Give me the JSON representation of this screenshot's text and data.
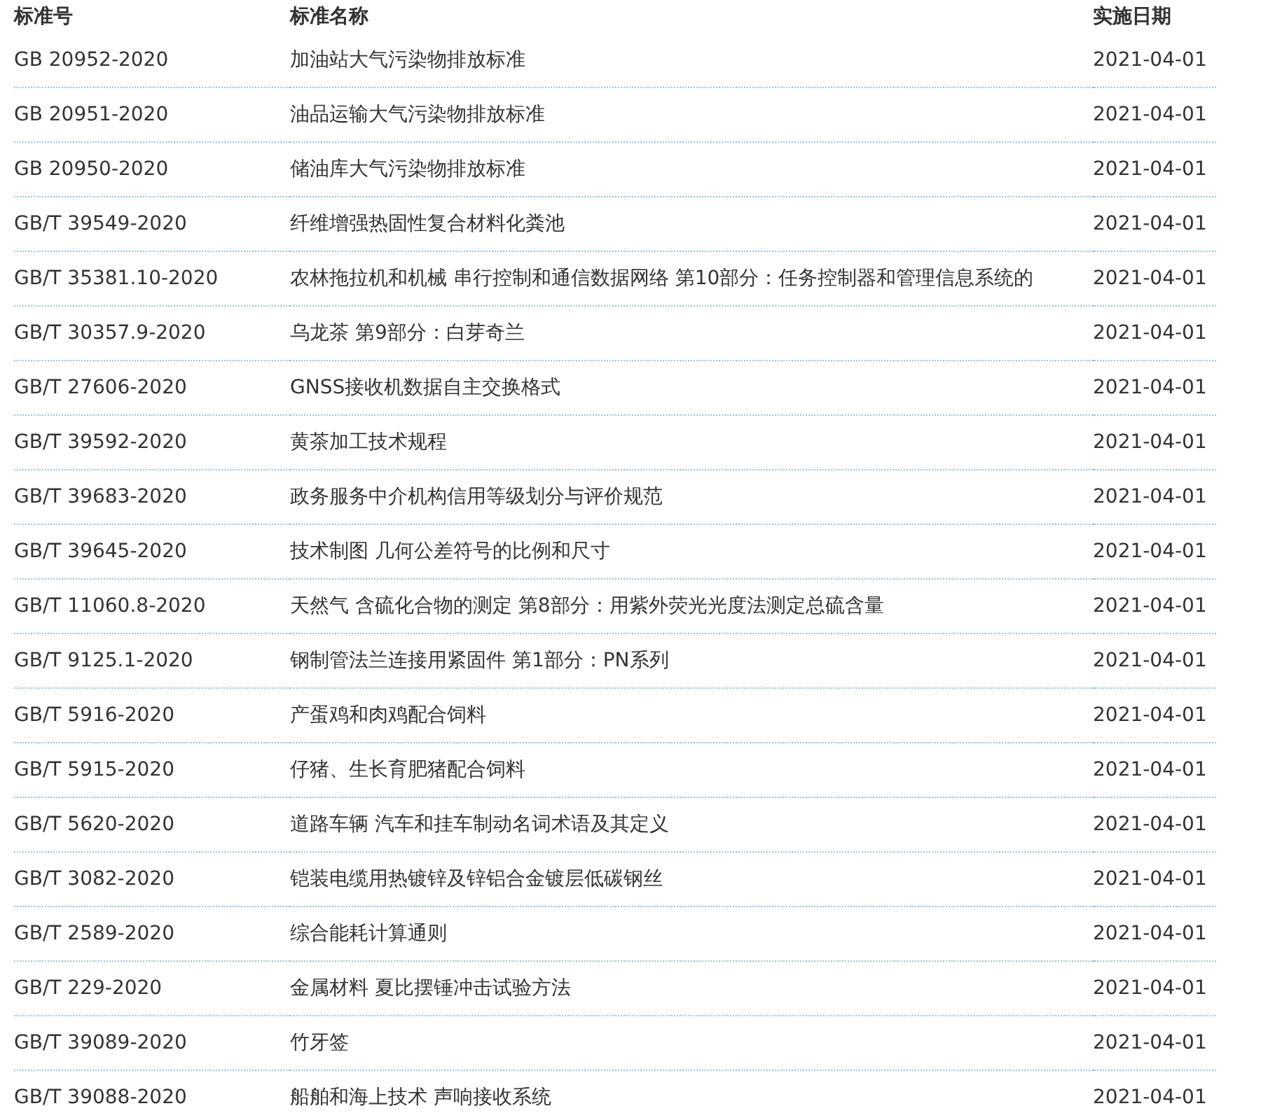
{
  "table": {
    "columns": [
      "标准号",
      "标准名称",
      "实施日期"
    ],
    "rows": [
      {
        "code": "GB 20952-2020",
        "name": "加油站大气污染物排放标准",
        "date": "2021-04-01"
      },
      {
        "code": "GB 20951-2020",
        "name": "油品运输大气污染物排放标准",
        "date": "2021-04-01"
      },
      {
        "code": "GB 20950-2020",
        "name": "储油库大气污染物排放标准",
        "date": "2021-04-01"
      },
      {
        "code": "GB/T 39549-2020",
        "name": "纤维增强热固性复合材料化粪池",
        "date": "2021-04-01"
      },
      {
        "code": "GB/T 35381.10-2020",
        "name": "农林拖拉机和机械 串行控制和通信数据网络 第10部分：任务控制器和管理信息系统的",
        "date": "2021-04-01"
      },
      {
        "code": "GB/T 30357.9-2020",
        "name": "乌龙茶 第9部分：白芽奇兰",
        "date": "2021-04-01"
      },
      {
        "code": "GB/T 27606-2020",
        "name": "GNSS接收机数据自主交换格式",
        "date": "2021-04-01"
      },
      {
        "code": "GB/T 39592-2020",
        "name": "黄茶加工技术规程",
        "date": "2021-04-01"
      },
      {
        "code": "GB/T 39683-2020",
        "name": "政务服务中介机构信用等级划分与评价规范",
        "date": "2021-04-01"
      },
      {
        "code": "GB/T 39645-2020",
        "name": "技术制图 几何公差符号的比例和尺寸",
        "date": "2021-04-01"
      },
      {
        "code": "GB/T 11060.8-2020",
        "name": "天然气 含硫化合物的测定 第8部分：用紫外荧光光度法测定总硫含量",
        "date": "2021-04-01"
      },
      {
        "code": "GB/T 9125.1-2020",
        "name": "钢制管法兰连接用紧固件 第1部分：PN系列",
        "date": "2021-04-01"
      },
      {
        "code": "GB/T 5916-2020",
        "name": "产蛋鸡和肉鸡配合饲料",
        "date": "2021-04-01"
      },
      {
        "code": "GB/T 5915-2020",
        "name": "仔猪、生长育肥猪配合饲料",
        "date": "2021-04-01"
      },
      {
        "code": "GB/T 5620-2020",
        "name": "道路车辆 汽车和挂车制动名词术语及其定义",
        "date": "2021-04-01"
      },
      {
        "code": "GB/T 3082-2020",
        "name": "铠装电缆用热镀锌及锌铝合金镀层低碳钢丝",
        "date": "2021-04-01"
      },
      {
        "code": "GB/T 2589-2020",
        "name": "综合能耗计算通则",
        "date": "2021-04-01"
      },
      {
        "code": "GB/T 229-2020",
        "name": "金属材料 夏比摆锤冲击试验方法",
        "date": "2021-04-01"
      },
      {
        "code": "GB/T 39089-2020",
        "name": "竹牙签",
        "date": "2021-04-01"
      },
      {
        "code": "GB/T 39088-2020",
        "name": "船舶和海上技术 声响接收系统",
        "date": "2021-04-01"
      }
    ]
  }
}
